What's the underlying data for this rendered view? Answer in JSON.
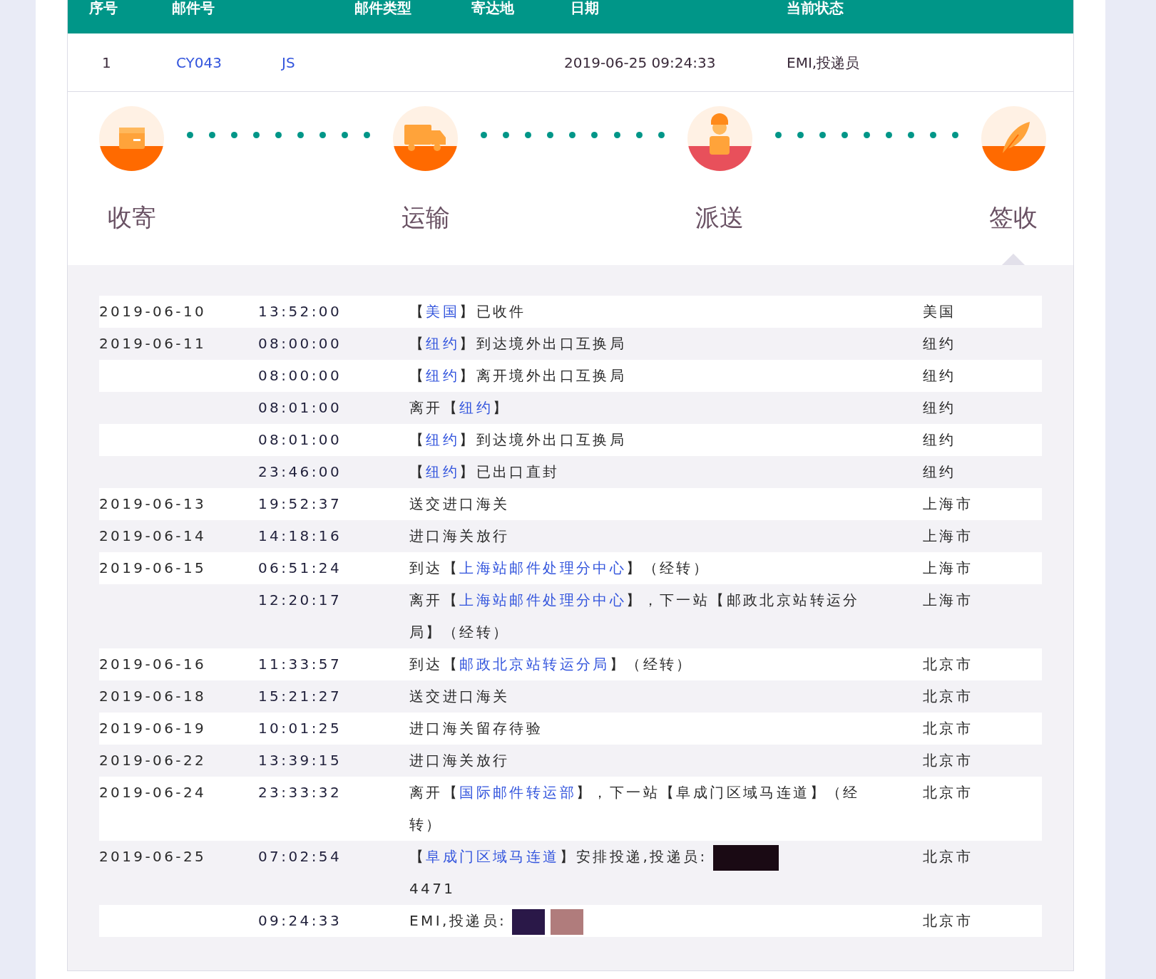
{
  "table_header": [
    "序号",
    "邮件号",
    "邮件类型",
    "寄达地",
    "日期",
    "当前状态"
  ],
  "summary_row": {
    "index": "1",
    "mail_number": [
      "CY043",
      "JS"
    ],
    "date": "2019-06-25 09:24:33",
    "status": "EMI,投递员"
  },
  "steps": [
    {
      "label": "收寄",
      "kind": "box",
      "current": false
    },
    {
      "label": "运输",
      "kind": "truck",
      "current": false
    },
    {
      "label": "派送",
      "kind": "courier",
      "current": false
    },
    {
      "label": "签收",
      "kind": "feather",
      "current": true
    }
  ],
  "events": [
    {
      "date": "2019-06-10",
      "time": "13:52:00",
      "description": [
        {
          "text": "【"
        },
        {
          "text": "美国",
          "link": true
        },
        {
          "text": "】已收件"
        }
      ],
      "location": "美国"
    },
    {
      "date": "2019-06-11",
      "time": "08:00:00",
      "description": [
        {
          "text": "【"
        },
        {
          "text": "纽约",
          "link": true
        },
        {
          "text": "】到达境外出口互换局"
        }
      ],
      "location": "纽约"
    },
    {
      "time": "08:00:00",
      "description": [
        {
          "text": "【"
        },
        {
          "text": "纽约",
          "link": true
        },
        {
          "text": "】离开境外出口互换局"
        }
      ],
      "location": "纽约"
    },
    {
      "time": "08:01:00",
      "description": [
        {
          "text": "离开【"
        },
        {
          "text": "纽约",
          "link": true
        },
        {
          "text": "】"
        }
      ],
      "location": "纽约"
    },
    {
      "time": "08:01:00",
      "description": [
        {
          "text": "【"
        },
        {
          "text": "纽约",
          "link": true
        },
        {
          "text": "】到达境外出口互换局"
        }
      ],
      "location": "纽约"
    },
    {
      "time": "23:46:00",
      "description": [
        {
          "text": "【"
        },
        {
          "text": "纽约",
          "link": true
        },
        {
          "text": "】已出口直封"
        }
      ],
      "location": "纽约"
    },
    {
      "date": "2019-06-13",
      "time": "19:52:37",
      "description": [
        {
          "text": "送交进口海关"
        }
      ],
      "location": "上海市"
    },
    {
      "date": "2019-06-14",
      "time": "14:18:16",
      "description": [
        {
          "text": "进口海关放行"
        }
      ],
      "location": "上海市"
    },
    {
      "date": "2019-06-15",
      "time": "06:51:24",
      "description": [
        {
          "text": "到达【"
        },
        {
          "text": "上海站邮件处理分中心",
          "link": true
        },
        {
          "text": "】（经转）"
        }
      ],
      "location": "上海市"
    },
    {
      "time": "12:20:17",
      "description": [
        {
          "text": "离开【"
        },
        {
          "text": "上海站邮件处理分中心",
          "link": true
        },
        {
          "text": "】，下一站【邮政北京站转运分局】（经转）"
        }
      ],
      "location": "上海市"
    },
    {
      "date": "2019-06-16",
      "time": "11:33:57",
      "description": [
        {
          "text": "到达【"
        },
        {
          "text": "邮政北京站转运分局",
          "link": true
        },
        {
          "text": "】（经转）"
        }
      ],
      "location": "北京市"
    },
    {
      "date": "2019-06-18",
      "time": "15:21:27",
      "description": [
        {
          "text": "送交进口海关"
        }
      ],
      "location": "北京市"
    },
    {
      "date": "2019-06-19",
      "time": "10:01:25",
      "description": [
        {
          "text": "进口海关留存待验"
        }
      ],
      "location": "北京市"
    },
    {
      "date": "2019-06-22",
      "time": "13:39:15",
      "description": [
        {
          "text": "进口海关放行"
        }
      ],
      "location": "北京市"
    },
    {
      "date": "2019-06-24",
      "time": "23:33:32",
      "description": [
        {
          "text": "离开【"
        },
        {
          "text": "国际邮件转运部",
          "link": true
        },
        {
          "text": "】，下一站【阜成门区域马连道】（经转）"
        }
      ],
      "location": "北京市"
    },
    {
      "date": "2019-06-25",
      "time": "07:02:54",
      "description": [
        {
          "text": "【"
        },
        {
          "text": "阜成门区域马连道",
          "link": true
        },
        {
          "text": "】安排投递,投递员:"
        },
        {
          "kind": "redaction",
          "color": "#1a0a14",
          "wide": true
        },
        {
          "text": "4471",
          "break": true
        }
      ],
      "location": "北京市"
    },
    {
      "time": "09:24:33",
      "description": [
        {
          "text": "EMI,投递员:"
        },
        {
          "kind": "redaction",
          "color": "#2a1848",
          "wide": false
        },
        {
          "kind": "redaction",
          "color": "#b07c7c",
          "wide": false
        }
      ],
      "location": "北京市"
    }
  ]
}
